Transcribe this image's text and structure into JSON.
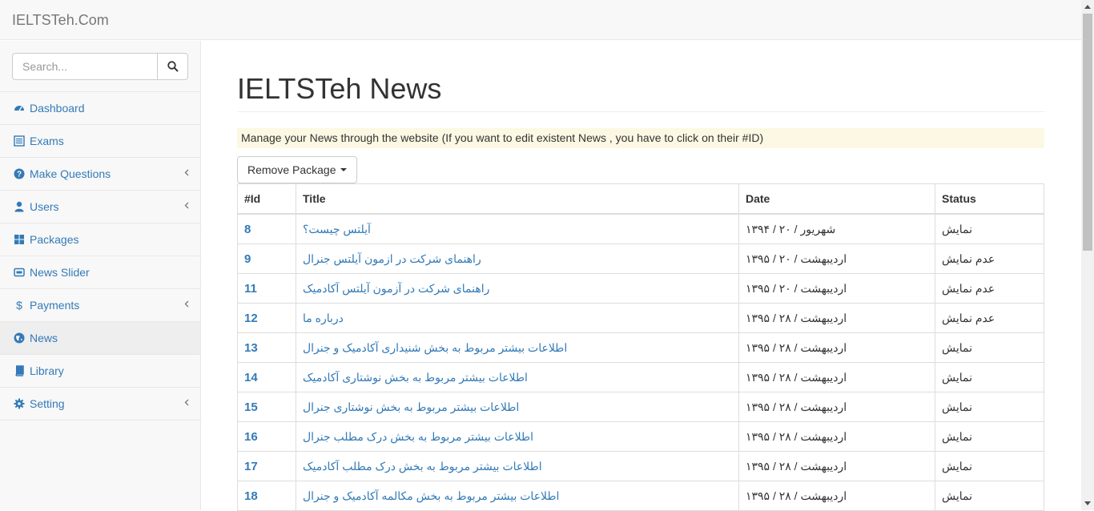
{
  "brand": "IELTSTeh.Com",
  "search": {
    "placeholder": "Search..."
  },
  "sidebar": {
    "items": [
      {
        "label": "Dashboard",
        "icon": "dashboard-icon",
        "has_arrow": false,
        "active": false
      },
      {
        "label": "Exams",
        "icon": "list-icon",
        "has_arrow": false,
        "active": false
      },
      {
        "label": "Make Questions",
        "icon": "question-icon",
        "has_arrow": true,
        "active": false
      },
      {
        "label": "Users",
        "icon": "user-icon",
        "has_arrow": true,
        "active": false
      },
      {
        "label": "Packages",
        "icon": "grid-icon",
        "has_arrow": false,
        "active": false
      },
      {
        "label": "News Slider",
        "icon": "slider-icon",
        "has_arrow": false,
        "active": false
      },
      {
        "label": "Payments",
        "icon": "dollar-icon",
        "has_arrow": true,
        "active": false
      },
      {
        "label": "News",
        "icon": "globe-icon",
        "has_arrow": false,
        "active": true
      },
      {
        "label": "Library",
        "icon": "book-icon",
        "has_arrow": false,
        "active": false
      },
      {
        "label": "Setting",
        "icon": "gear-icon",
        "has_arrow": true,
        "active": false
      }
    ]
  },
  "main": {
    "title": "IELTSTeh News",
    "notice": "Manage your News through the website (If you want to edit existent News , you have to click on their #ID)",
    "dropdown_label": "Remove Package",
    "table": {
      "headers": [
        "#Id",
        "Title",
        "Date",
        "Status"
      ],
      "rows": [
        {
          "id": "8",
          "title": "آیلتس چیست؟",
          "date": "شهریور / ۲۰ / ۱۳۹۴",
          "status": "نمایش"
        },
        {
          "id": "9",
          "title": "راهنمای شرکت در ازمون آیلتس جنرال",
          "date": "اردیبهشت / ۲۰ / ۱۳۹۵",
          "status": "عدم نمایش"
        },
        {
          "id": "11",
          "title": "راهنمای شرکت در آزمون آیلتس آکادمیک",
          "date": "اردیبهشت / ۲۰ / ۱۳۹۵",
          "status": "عدم نمایش"
        },
        {
          "id": "12",
          "title": "درباره ما",
          "date": "اردیبهشت / ۲۸ / ۱۳۹۵",
          "status": "عدم نمایش"
        },
        {
          "id": "13",
          "title": "اطلاعات بیشتر مربوط به بخش شنیداری آکادمیک و جنرال",
          "date": "اردیبهشت / ۲۸ / ۱۳۹۵",
          "status": "نمایش"
        },
        {
          "id": "14",
          "title": "اطلاعات بیشتر مربوط به بخش نوشتاری آکادمیک",
          "date": "اردیبهشت / ۲۸ / ۱۳۹۵",
          "status": "نمایش"
        },
        {
          "id": "15",
          "title": "اطلاعات بیشتر مربوط به بخش نوشتاری جنرال",
          "date": "اردیبهشت / ۲۸ / ۱۳۹۵",
          "status": "نمایش"
        },
        {
          "id": "16",
          "title": "اطلاعات بیشتر مربوط به بخش درک مطلب جنرال",
          "date": "اردیبهشت / ۲۸ / ۱۳۹۵",
          "status": "نمایش"
        },
        {
          "id": "17",
          "title": "اطلاعات بیشتر مربوط به بخش درک مطلب آکادمیک",
          "date": "اردیبهشت / ۲۸ / ۱۳۹۵",
          "status": "نمایش"
        },
        {
          "id": "18",
          "title": "اطلاعات بیشتر مربوط به بخش مکالمه آکادمیک و جنرال",
          "date": "اردیبهشت / ۲۸ / ۱۳۹۵",
          "status": "نمایش"
        }
      ]
    }
  },
  "colors": {
    "link": "#337ab7",
    "notice_bg": "#fcf8e3",
    "sidebar_bg": "#f8f8f8"
  }
}
